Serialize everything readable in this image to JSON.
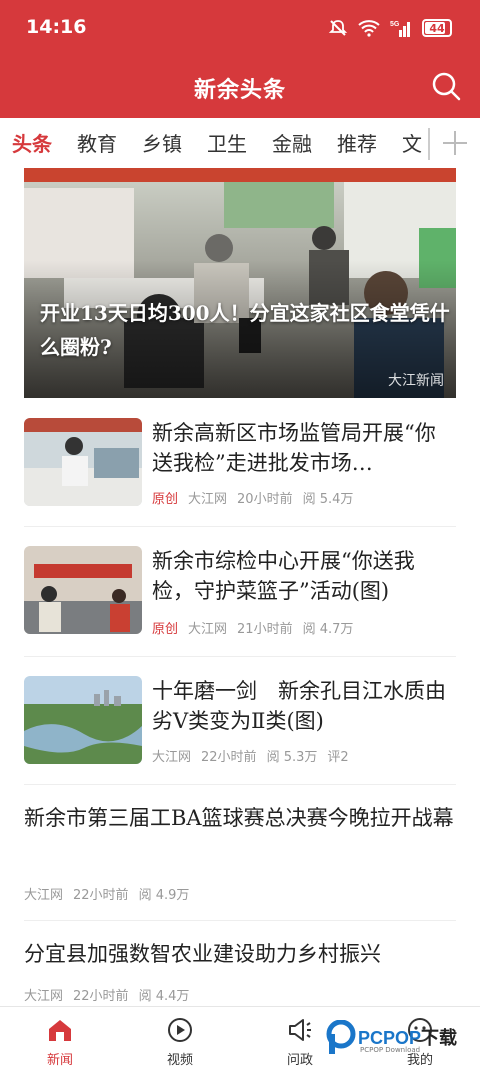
{
  "status": {
    "time": "14:16",
    "network": "5G",
    "battery": "44"
  },
  "app": {
    "title": "新余头条"
  },
  "tabs": [
    {
      "label": "头条",
      "active": true
    },
    {
      "label": "教育"
    },
    {
      "label": "乡镇"
    },
    {
      "label": "卫生"
    },
    {
      "label": "金融"
    },
    {
      "label": "推荐"
    },
    {
      "label": "文"
    }
  ],
  "hero": {
    "title": "开业13天日均300人！分宜这家社区食堂凭什么圈粉?",
    "watermark": "大江新闻"
  },
  "news": [
    {
      "title": "新余高新区市场监管局开展“你送我检”走进批发市场…",
      "tag": "原创",
      "source": "大江网",
      "time": "20小时前",
      "reads": "阅 5.4万",
      "comments": ""
    },
    {
      "title": "新余市综检中心开展“你送我检，守护菜篮子”活动(图)",
      "tag": "原创",
      "source": "大江网",
      "time": "21小时前",
      "reads": "阅 4.7万",
      "comments": ""
    },
    {
      "title": "十年磨一剑　新余孔目江水质由劣V类变为Ⅱ类(图)",
      "tag": "",
      "source": "大江网",
      "time": "22小时前",
      "reads": "阅 5.3万",
      "comments": "评2"
    }
  ],
  "text_news": [
    {
      "title": "新余市第三届工BA篮球赛总决赛今晚拉开战幕",
      "source": "大江网",
      "time": "22小时前",
      "reads": "阅 4.9万"
    },
    {
      "title": "分宜县加强数智农业建设助力乡村振兴",
      "source": "大江网",
      "time": "22小时前",
      "reads": "阅 4.4万"
    }
  ],
  "bottom_nav": [
    {
      "label": "新闻",
      "icon": "home-icon",
      "active": true
    },
    {
      "label": "视频",
      "icon": "play-icon"
    },
    {
      "label": "问政",
      "icon": "megaphone-icon"
    },
    {
      "label": "我的",
      "icon": "user-icon"
    }
  ],
  "watermark": {
    "brand": "PCPOP",
    "suffix": "下载",
    "sub": "PCPOP Download"
  },
  "colors": {
    "accent": "#d6393c",
    "meta": "#999999"
  }
}
